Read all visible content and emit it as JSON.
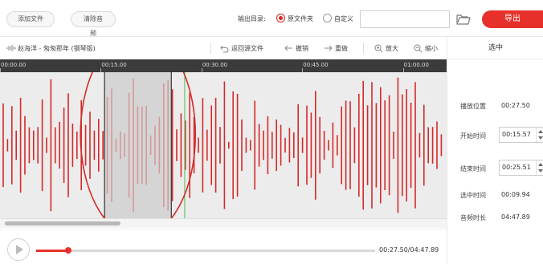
{
  "toolbar": {
    "add_file": "添加文件",
    "clear_audio": "清除音频",
    "output_dir_label": "输出目录:",
    "option_original": "原文件夹",
    "option_custom": "自定义",
    "output_path": "",
    "export": "导出"
  },
  "track": {
    "title": "赵海洋 - 匆匆那年 (钢琴版)",
    "tools": {
      "back_to_source": "返回源文件",
      "undo": "撤销",
      "redo": "重做",
      "zoom_in": "放大",
      "zoom_out": "缩小"
    }
  },
  "ruler": {
    "ticks": [
      "00:00.00",
      "00:15.00",
      "00:30.00",
      "00:45.00",
      "01:00.00"
    ]
  },
  "selection_panel": {
    "header": "选中",
    "play_position_label": "播放位置",
    "play_position": "00:27.50",
    "start_label": "开始时间",
    "start": "00:15.57",
    "end_label": "结束时间",
    "end": "00:25.51",
    "selected_label": "选中时间",
    "selected": "00:09.94",
    "duration_label": "音频时长",
    "duration": "04:47.89"
  },
  "waveform": {
    "visible_start_s": 0,
    "visible_end_s": 66.5,
    "selection_start_s": 15.57,
    "selection_end_s": 25.51,
    "playhead_s": 27.5
  },
  "playback": {
    "time_readout": "00:27.50/04:47.89",
    "progress_fraction": 0.0955
  },
  "colors": {
    "accent": "#e8302a",
    "wave": "#d42a2a",
    "selection_fill": "#d5d5d5",
    "annotation_circle": "#d42a2a",
    "playhead": "#4cc24c"
  }
}
